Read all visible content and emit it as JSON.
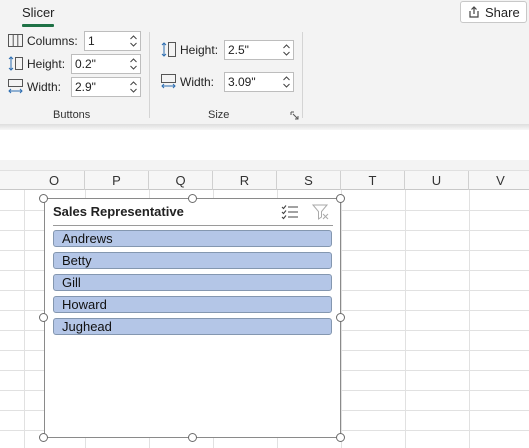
{
  "ribbon": {
    "tab": "Slicer",
    "share_label": "Share",
    "buttons_group": {
      "label": "Buttons",
      "columns": {
        "label": "Columns:",
        "value": "1"
      },
      "height": {
        "label": "Height:",
        "value": "0.2\""
      },
      "width": {
        "label": "Width:",
        "value": "2.9\""
      }
    },
    "size_group": {
      "label": "Size",
      "height": {
        "label": "Height:",
        "value": "2.5\""
      },
      "width": {
        "label": "Width:",
        "value": "3.09\""
      }
    }
  },
  "sheet": {
    "columns": [
      "O",
      "P",
      "Q",
      "R",
      "S",
      "T",
      "U",
      "V"
    ]
  },
  "slicer": {
    "title": "Sales Representative",
    "items": [
      "Andrews",
      "Betty",
      "Gill",
      "Howard",
      "Jughead"
    ],
    "item_color": "#b4c6e7"
  },
  "icons": {
    "share": "share-icon",
    "columns": "columns-icon",
    "button_height": "button-height-icon",
    "button_width": "button-width-icon",
    "size_height": "size-height-icon",
    "size_width": "size-width-icon",
    "multi_select": "multi-select-icon",
    "clear_filter": "clear-filter-icon"
  }
}
